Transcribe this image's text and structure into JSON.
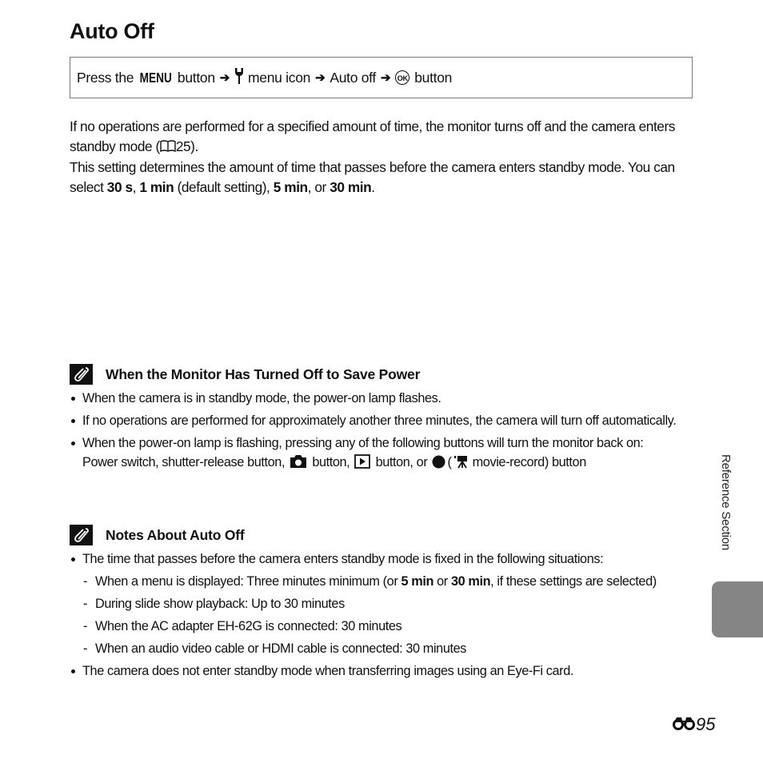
{
  "page": {
    "title": "Auto Off",
    "procedure": {
      "press_the": "Press the",
      "menu_word": "MENU",
      "button_1": "button",
      "arrow": "➔",
      "menu_icon_text": "menu icon",
      "item": "Auto off",
      "ok_label": "OK",
      "button_2": "button",
      "icons": [
        "menu-button-icon",
        "wrench-icon",
        "ok-button-icon"
      ]
    },
    "intro": {
      "p1_text": "If no operations are performed for a specified amount of time, the monitor turns off and the camera enters standby mode (",
      "p1_ref": "25",
      "p1_end": ").",
      "p2_a": "This setting determines the amount of time that passes before the camera enters standby mode. You can select ",
      "opt1": "30 s",
      "sep1": ", ",
      "opt2": "1 min",
      "p2_b": " (default setting), ",
      "opt3": "5 min",
      "p2_c": ", or ",
      "opt4": "30 min",
      "p2_d": "."
    },
    "note1": {
      "title": "When the Monitor Has Turned Off to Save Power",
      "b1": "When the camera is in standby mode, the power-on lamp flashes.",
      "b2": "If no operations are performed for approximately another three minutes, the camera will turn off automatically.",
      "b3_line1": "When the power-on lamp is flashing, pressing any of the following buttons will turn the monitor back on:",
      "b3_l2a": "Power switch, shutter-release button,",
      "b3_l2b": "button,",
      "b3_l2c": "button, or",
      "b3_l2d": "(",
      "b3_l2e": "movie-record) button"
    },
    "note2": {
      "title": "Notes About Auto Off",
      "b1": "The time that passes before the camera enters standby mode is fixed in the following situations:",
      "d1_a": "When a menu is displayed: Three minutes minimum (or ",
      "d1_b": "5 min",
      "d1_c": " or ",
      "d1_d": "30 min",
      "d1_e": ", if these settings are selected)",
      "d2": "During slide show playback: Up to 30 minutes",
      "d3": "When the AC adapter EH-62G is connected: 30 minutes",
      "d4": "When an audio video cable or HDMI cable is connected: 30 minutes",
      "b2": "The camera does not enter standby mode when transferring images using an Eye-Fi card."
    },
    "side_label": "Reference Section",
    "page_number": "95"
  }
}
